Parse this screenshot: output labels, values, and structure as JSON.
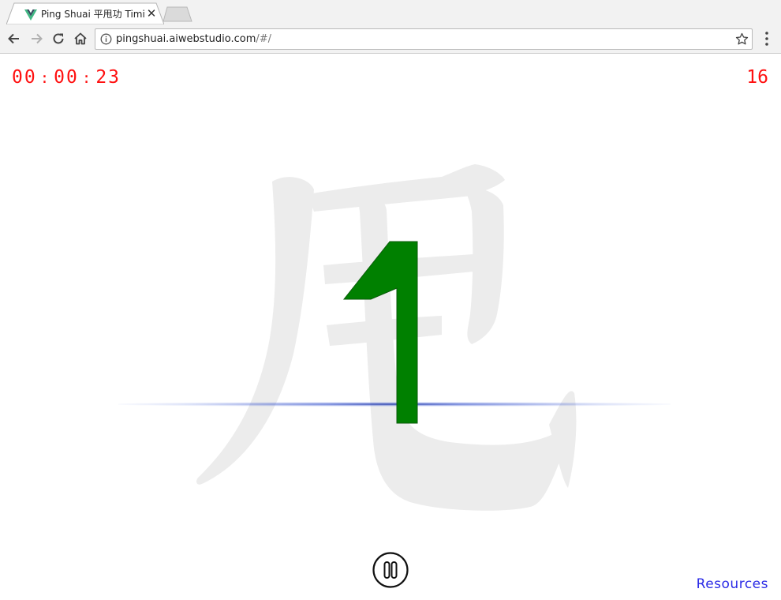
{
  "browser": {
    "tab_title": "Ping Shuai 平甩功 Timing",
    "url_host": "pingshuai.aiwebstudio.com",
    "url_path": "/#/"
  },
  "session": {
    "timer_hours": "00",
    "timer_minutes": "00",
    "timer_seconds": "23",
    "colon": ":",
    "count": "16"
  },
  "display": {
    "current_digit": "1",
    "digit_color": "#008000",
    "background_glyph": "甩"
  },
  "controls": {
    "pause_icon": "pause-icon"
  },
  "links": {
    "resources": "Resources"
  },
  "colors": {
    "timer": "#ff1010",
    "link": "#2a2ae6",
    "horizon": "#0a1e8c"
  }
}
